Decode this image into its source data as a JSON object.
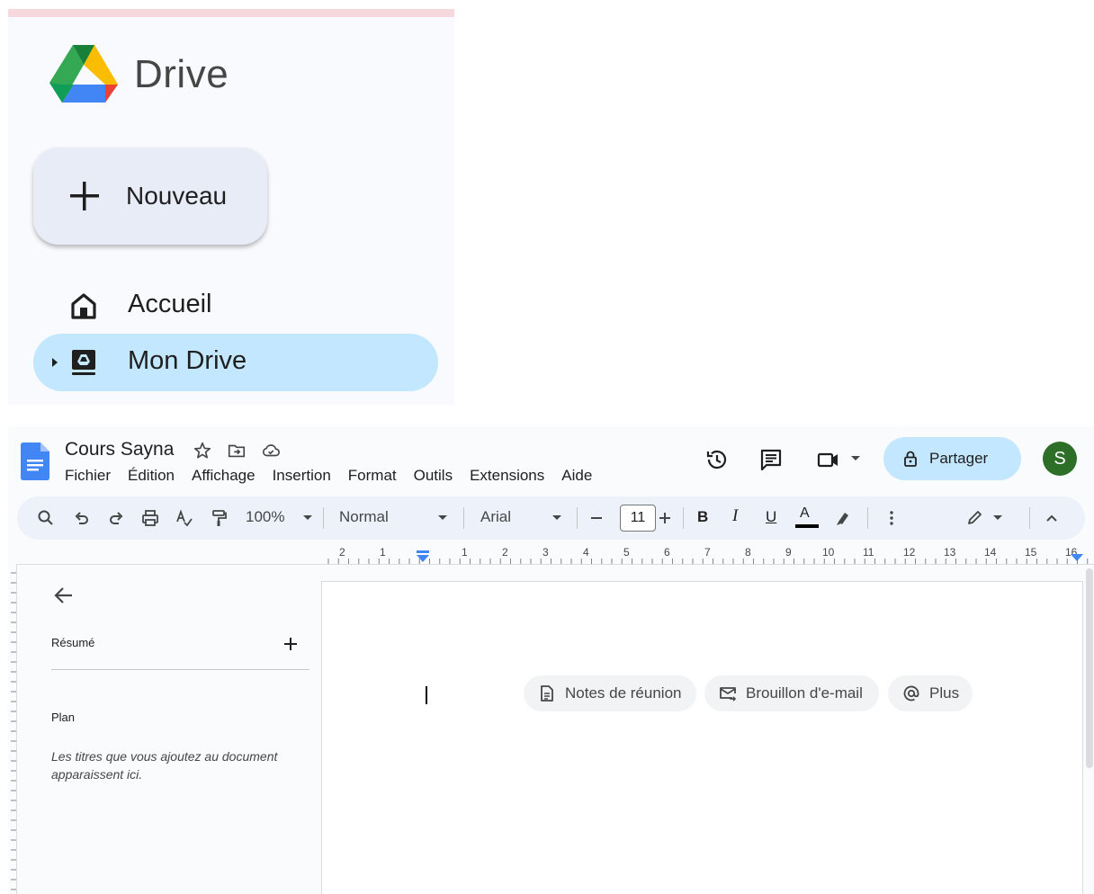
{
  "drive": {
    "title": "Drive",
    "new_button": "Nouveau",
    "nav": [
      {
        "label": "Accueil",
        "icon": "home-icon",
        "selected": false
      },
      {
        "label": "Mon Drive",
        "icon": "my-drive-icon",
        "selected": true
      }
    ]
  },
  "docs": {
    "doc_title": "Cours Sayna",
    "menu": [
      "Fichier",
      "Édition",
      "Affichage",
      "Insertion",
      "Format",
      "Outils",
      "Extensions",
      "Aide"
    ],
    "share_label": "Partager",
    "avatar_initial": "S",
    "toolbar": {
      "zoom": "100%",
      "style": "Normal",
      "font": "Arial",
      "font_size": "11",
      "bold": "B",
      "italic": "I",
      "underline": "U",
      "text_color": "A"
    },
    "ruler_left": [
      "2",
      "1"
    ],
    "ruler_right": [
      "1",
      "2",
      "3",
      "4",
      "5",
      "6",
      "7",
      "8",
      "9",
      "10",
      "11",
      "12",
      "13",
      "14",
      "15",
      "16"
    ],
    "outline": {
      "summary_label": "Résumé",
      "plan_label": "Plan",
      "plan_hint": "Les titres que vous ajoutez au document apparaissent ici."
    },
    "chips": [
      {
        "label": "Notes de réunion",
        "icon": "document-icon"
      },
      {
        "label": "Brouillon d'e-mail",
        "icon": "email-draft-icon"
      },
      {
        "label": "Plus",
        "icon": "at-sign-icon"
      }
    ]
  },
  "colors": {
    "drive_bg": "#f8fafd",
    "selected_nav": "#c2e7ff",
    "share_button": "#c2e7ff",
    "avatar": "#2d6e28",
    "docs_blue": "#4285f4"
  }
}
